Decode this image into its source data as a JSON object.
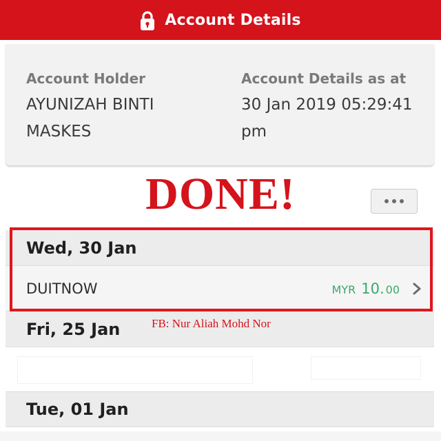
{
  "header": {
    "title": "Account Details",
    "icon": "lock-icon",
    "background": "#d4131b"
  },
  "account": {
    "holder_label": "Account Holder",
    "holder_line1": "AYUNIZAH BINTI",
    "holder_line2": "MASKES",
    "as_at_label": "Account Details as at",
    "as_at_line1": "30 Jan 2019 05:29:41",
    "as_at_line2": "pm"
  },
  "overlay": {
    "done_text": "DONE!",
    "watermark": "FB: Nur Aliah Mohd Nor",
    "accent": "#d4131b"
  },
  "more_button": {
    "icon": "ellipsis-icon"
  },
  "transactions": [
    {
      "date": "Wed, 30 Jan",
      "items": [
        {
          "name": "DUITNOW",
          "currency": "MYR",
          "amount_int": "10.",
          "amount_dec": "00",
          "amount_color": "#3aa86b",
          "icon": "chevron-right-icon"
        }
      ]
    },
    {
      "date": "Fri, 25 Jan"
    },
    {
      "date": "Tue, 01 Jan"
    }
  ]
}
